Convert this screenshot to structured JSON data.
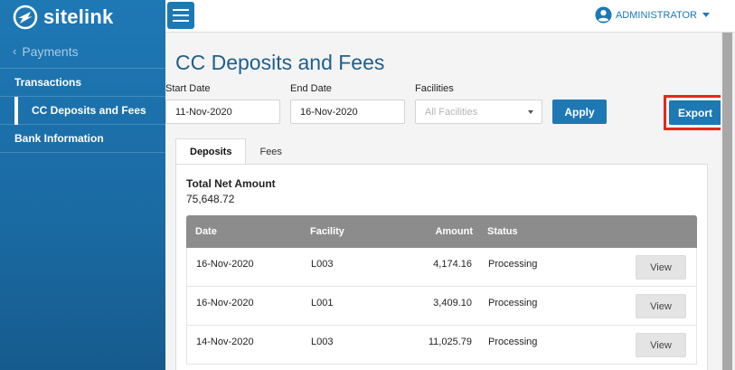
{
  "brand": {
    "name": "sitelink"
  },
  "sidebar": {
    "back_label": "Payments",
    "items": [
      {
        "label": "Transactions"
      },
      {
        "label": "CC Deposits and Fees"
      },
      {
        "label": "Bank Information"
      }
    ]
  },
  "topbar": {
    "user_label": "ADMINISTRATOR"
  },
  "page": {
    "title": "CC Deposits and Fees"
  },
  "filters": {
    "start_date_label": "Start Date",
    "start_date_value": "11-Nov-2020",
    "end_date_label": "End Date",
    "end_date_value": "16-Nov-2020",
    "facilities_label": "Facilities",
    "facilities_placeholder": "All Facilities",
    "apply_label": "Apply",
    "export_label": "Export"
  },
  "tabs": [
    {
      "label": "Deposits",
      "active": true
    },
    {
      "label": "Fees",
      "active": false
    }
  ],
  "summary": {
    "total_net_amount_label": "Total Net Amount",
    "total_net_amount_value": "75,648.72"
  },
  "table": {
    "headers": {
      "date": "Date",
      "facility": "Facility",
      "amount": "Amount",
      "status": "Status"
    },
    "rows": [
      {
        "date": "16-Nov-2020",
        "facility": "L003",
        "amount": "4,174.16",
        "status": "Processing",
        "action": "View"
      },
      {
        "date": "16-Nov-2020",
        "facility": "L001",
        "amount": "3,409.10",
        "status": "Processing",
        "action": "View"
      },
      {
        "date": "14-Nov-2020",
        "facility": "L003",
        "amount": "11,025.79",
        "status": "Processing",
        "action": "View"
      }
    ]
  },
  "colors": {
    "brand_blue": "#1e78b4",
    "title_blue": "#1f5f8c",
    "highlight_red": "#e8261b",
    "table_header": "#8c8c8c"
  }
}
